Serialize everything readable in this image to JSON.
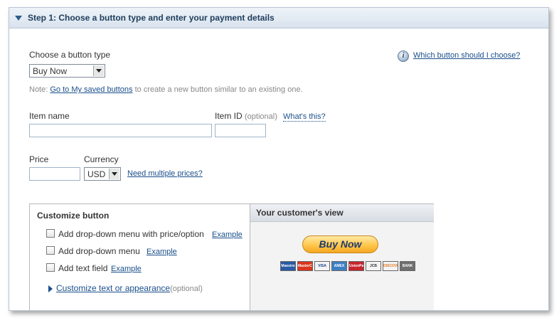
{
  "step": {
    "title": "Step 1: Choose a button type and enter your payment details"
  },
  "button_type": {
    "label": "Choose a button type",
    "selected": "Buy Now"
  },
  "help_link": "Which button should I choose?",
  "note": {
    "prefix": "Note:",
    "link": "Go to My saved buttons",
    "suffix": "to create a new button similar to an existing one."
  },
  "item_name": {
    "label": "Item name",
    "value": ""
  },
  "item_id": {
    "label": "Item ID",
    "optional": "(optional)",
    "help": "What's this?",
    "value": ""
  },
  "price": {
    "label": "Price",
    "value": ""
  },
  "currency": {
    "label": "Currency",
    "selected": "USD",
    "multiple_link": "Need multiple prices?"
  },
  "customize": {
    "title": "Customize button",
    "options": [
      {
        "label": "Add drop-down menu with price/option",
        "example": "Example"
      },
      {
        "label": "Add drop-down menu",
        "example": "Example"
      },
      {
        "label": "Add text field",
        "example": "Example"
      }
    ],
    "appearance_link": "Customize text or appearance",
    "appearance_optional": "(optional)"
  },
  "preview": {
    "title": "Your customer's view",
    "button_label": "Buy Now",
    "cards": [
      {
        "name": "Maestro",
        "color": "#2a5aa6"
      },
      {
        "name": "MasterCard",
        "color": "#d9361e"
      },
      {
        "name": "VISA",
        "color": "#f4f4f4",
        "text_color": "#1a3f8f"
      },
      {
        "name": "AMEX",
        "color": "#3d7fc4"
      },
      {
        "name": "UnionPay",
        "color": "#c8242c"
      },
      {
        "name": "JCB",
        "color": "#f4f4f4",
        "text_color": "#333"
      },
      {
        "name": "DISCOVER",
        "color": "#f4f4f4",
        "text_color": "#e47a1c"
      },
      {
        "name": "BANK",
        "color": "#6f6f6f"
      }
    ]
  }
}
